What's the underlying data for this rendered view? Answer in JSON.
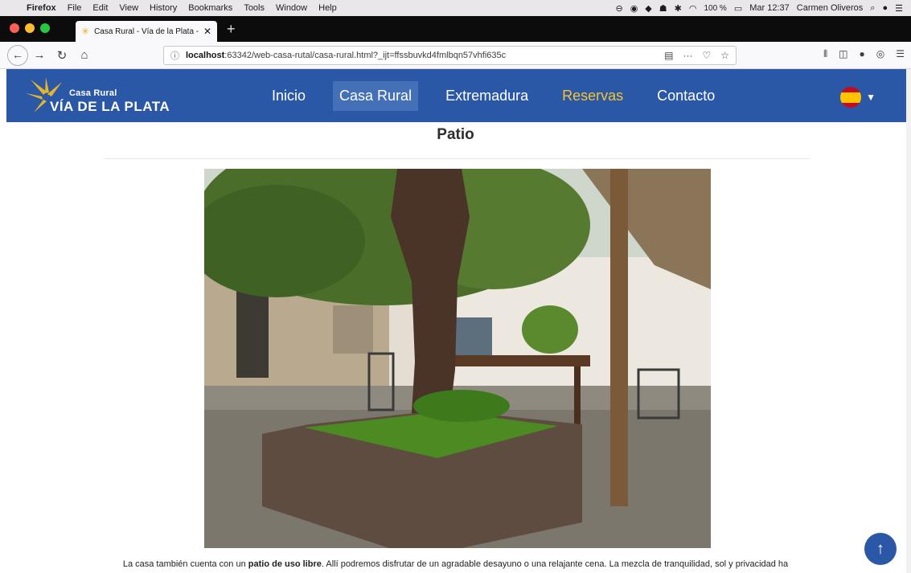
{
  "mac_menubar": {
    "app": "Firefox",
    "items": [
      "File",
      "Edit",
      "View",
      "History",
      "Bookmarks",
      "Tools",
      "Window",
      "Help"
    ],
    "battery": "100 %",
    "clock": "Mar 12:37",
    "user": "Carmen Oliveros"
  },
  "browser": {
    "tab_title": "Casa Rural - Vía de la Plata - C",
    "url_host": "localhost",
    "url_rest": ":63342/web-casa-rutal/casa-rural.html?_ijt=ffssbuvkd4fmlbqn57vhfi635c"
  },
  "site": {
    "logo_small": "Casa Rural",
    "logo_big": "VÍA DE LA PLATA",
    "nav": [
      {
        "label": "Inicio"
      },
      {
        "label": "Casa Rural"
      },
      {
        "label": "Extremadura"
      },
      {
        "label": "Reservas"
      },
      {
        "label": "Contacto"
      }
    ],
    "colors": {
      "header": "#2b58a6",
      "highlight": "#f5c431",
      "active": "#4470b8"
    }
  },
  "content": {
    "heading": "Patio",
    "desc_before": "La casa también cuenta con un ",
    "desc_bold": "patio de uso libre",
    "desc_after": ". Allí podremos disfrutar de un agradable desayuno o una relajante cena. La mezcla de tranquilidad, sol y privacidad ha"
  }
}
